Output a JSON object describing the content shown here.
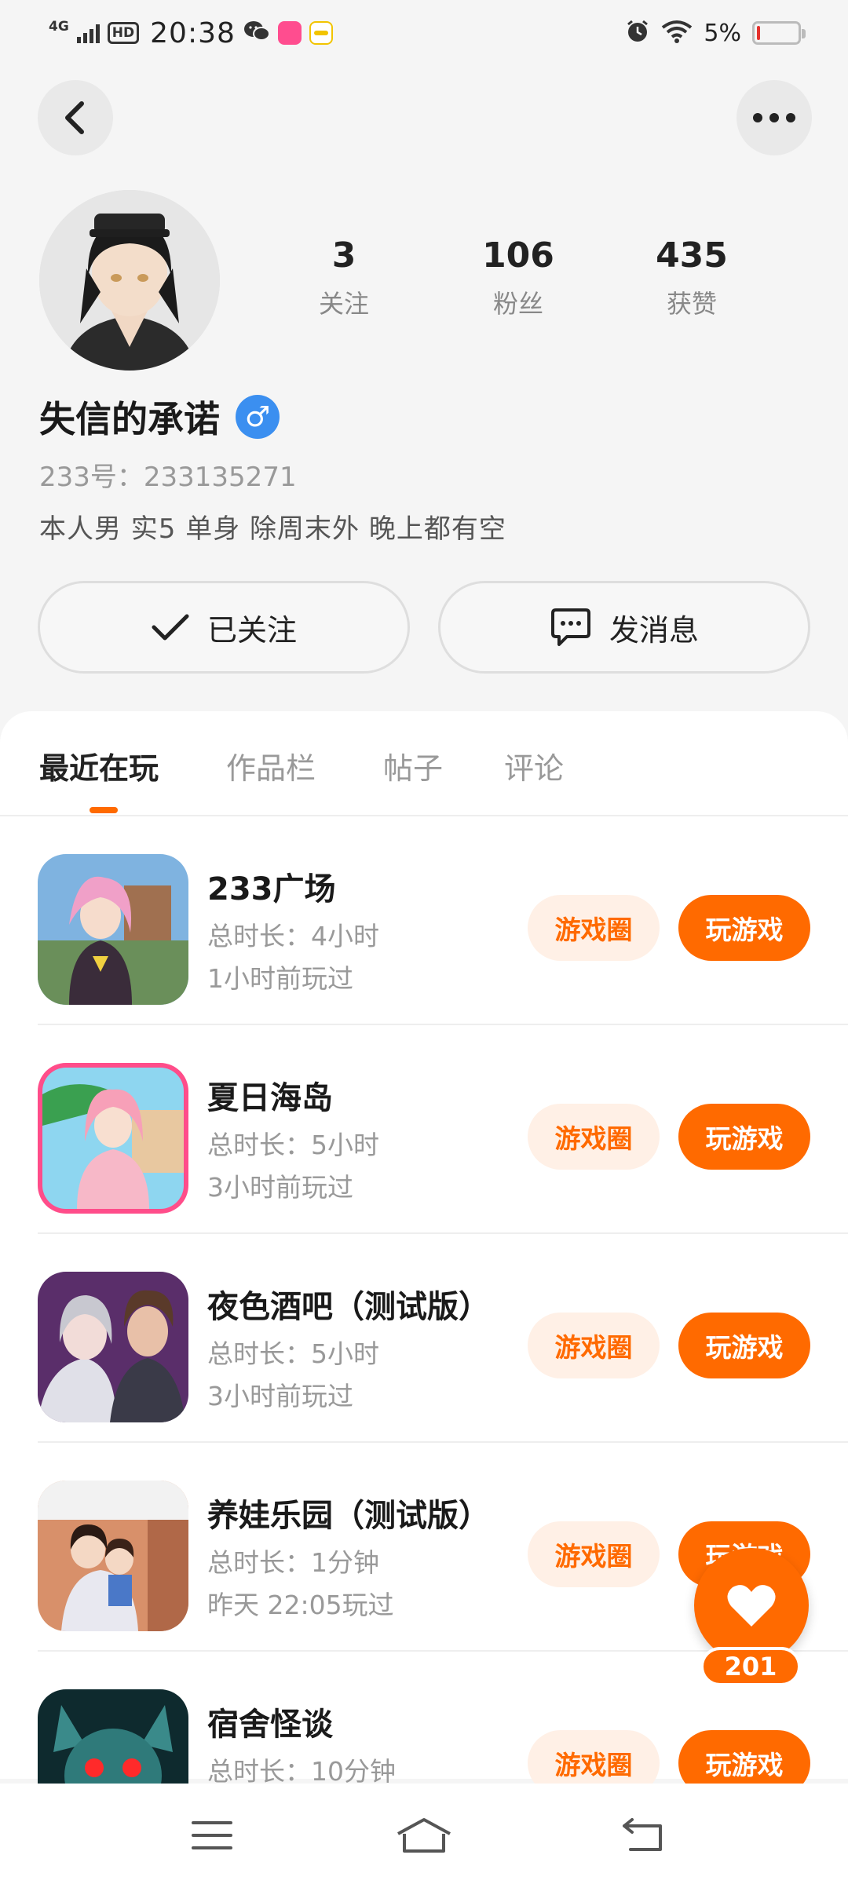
{
  "status_bar": {
    "network": "4G",
    "hd": "HD",
    "time": "20:38",
    "battery_percent": "5%",
    "battery_level": 0.05
  },
  "profile": {
    "stats": [
      {
        "value": "3",
        "label": "关注"
      },
      {
        "value": "106",
        "label": "粉丝"
      },
      {
        "value": "435",
        "label": "获赞"
      }
    ],
    "name": "失信的承诺",
    "gender_symbol": "♂",
    "uid": "233号：233135271",
    "bio": "本人男  实5  单身  除周末外  晚上都有空",
    "follow_label": "已关注",
    "message_label": "发消息"
  },
  "tabs": [
    {
      "label": "最近在玩",
      "active": true
    },
    {
      "label": "作品栏",
      "active": false
    },
    {
      "label": "帖子",
      "active": false
    },
    {
      "label": "评论",
      "active": false
    }
  ],
  "games": [
    {
      "title": "233广场",
      "duration": "总时长：4小时",
      "last_played": "1小时前玩过"
    },
    {
      "title": "夏日海岛",
      "duration": "总时长：5小时",
      "last_played": "3小时前玩过"
    },
    {
      "title": "夜色酒吧（测试版）",
      "duration": "总时长：5小时",
      "last_played": "3小时前玩过"
    },
    {
      "title": "养娃乐园（测试版）",
      "duration": "总时长：1分钟",
      "last_played": "昨天  22:05玩过"
    },
    {
      "title": "宿舍怪谈",
      "duration": "总时长：10分钟",
      "last_played": ""
    }
  ],
  "game_buttons": {
    "circle": "游戏圈",
    "play": "玩游戏"
  },
  "fab": {
    "count": "201"
  },
  "colors": {
    "accent": "#ff6a00",
    "accent_light": "#fff0e6",
    "gender": "#3b8ff0"
  }
}
